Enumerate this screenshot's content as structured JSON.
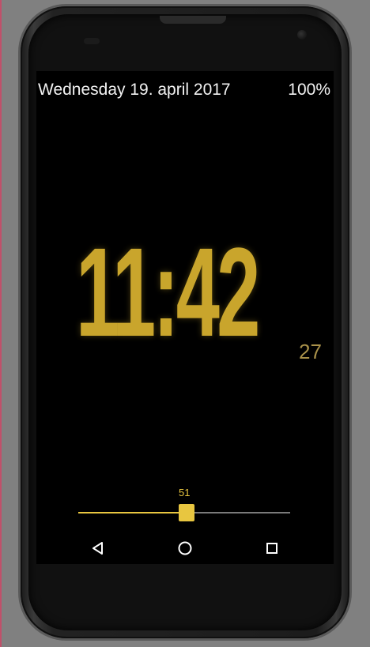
{
  "status_bar": {
    "date": "Wednesday 19. april 2017",
    "battery": "100%"
  },
  "clock": {
    "time": "11:42",
    "seconds": "27",
    "color": "#c9a52c"
  },
  "brightness_slider": {
    "value_label": "51",
    "value": 51,
    "max": 100,
    "accent_color": "#e8c640"
  },
  "nav_bar": {
    "back_icon": "back-triangle-icon",
    "home_icon": "home-circle-icon",
    "recent_icon": "recent-apps-square-icon"
  }
}
